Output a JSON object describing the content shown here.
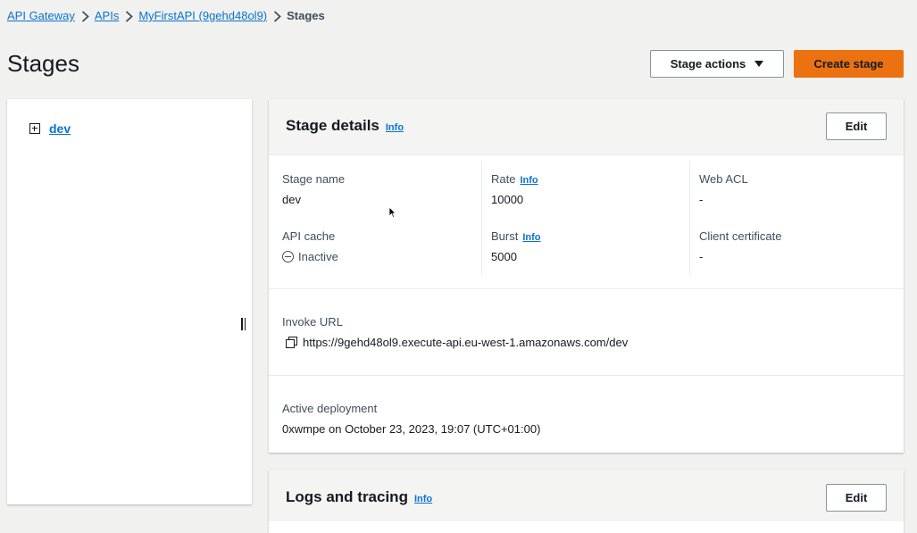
{
  "breadcrumb": {
    "items": [
      "API Gateway",
      "APIs",
      "MyFirstAPI (9gehd48ol9)"
    ],
    "current": "Stages"
  },
  "page": {
    "title": "Stages",
    "stage_actions_label": "Stage actions",
    "create_stage_label": "Create stage"
  },
  "tree": {
    "items": [
      {
        "label": "dev"
      }
    ]
  },
  "stage_details": {
    "title": "Stage details",
    "info_label": "Info",
    "edit_label": "Edit",
    "stage_name_label": "Stage name",
    "stage_name_value": "dev",
    "rate_label": "Rate",
    "rate_value": "10000",
    "web_acl_label": "Web ACL",
    "web_acl_value": "-",
    "api_cache_label": "API cache",
    "api_cache_value": "Inactive",
    "burst_label": "Burst",
    "burst_value": "5000",
    "client_cert_label": "Client certificate",
    "client_cert_value": "-",
    "invoke_url_label": "Invoke URL",
    "invoke_url_value": "https://9gehd48ol9.execute-api.eu-west-1.amazonaws.com/dev",
    "active_deployment_label": "Active deployment",
    "active_deployment_value": "0xwmpe on October 23, 2023, 19:07 (UTC+01:00)"
  },
  "logs_tracing": {
    "title": "Logs and tracing",
    "info_label": "Info",
    "edit_label": "Edit"
  },
  "colors": {
    "link": "#0972d3",
    "primary_button": "#ec7211",
    "background": "#f1f1ef"
  }
}
